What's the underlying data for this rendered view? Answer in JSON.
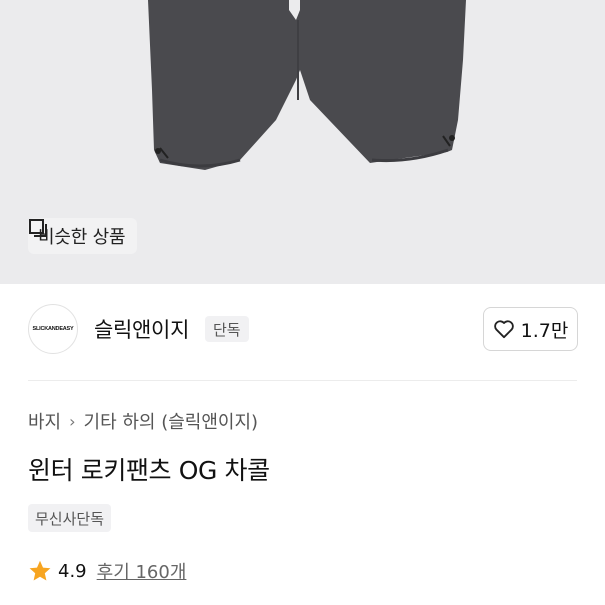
{
  "similar_button": {
    "label": "비슷한 상품",
    "icon": "similar-products-icon"
  },
  "brand": {
    "logo_text": "SLICKANDEASY",
    "name": "슬릭앤이지",
    "exclusive_tag": "단독",
    "likes": "1.7만",
    "like_icon": "heart-icon"
  },
  "breadcrumb": {
    "category": "바지",
    "subcategory": "기타 하의 (슬릭앤이지)"
  },
  "product": {
    "title": "윈터 로키팬츠 OG 차콜",
    "badge": "무신사단독"
  },
  "rating": {
    "score": "4.9",
    "reviews": "후기 160개",
    "star_color": "#F7A521"
  },
  "colors": {
    "hero_bg": "#EBEBED",
    "pants": "#4A4A4E"
  }
}
